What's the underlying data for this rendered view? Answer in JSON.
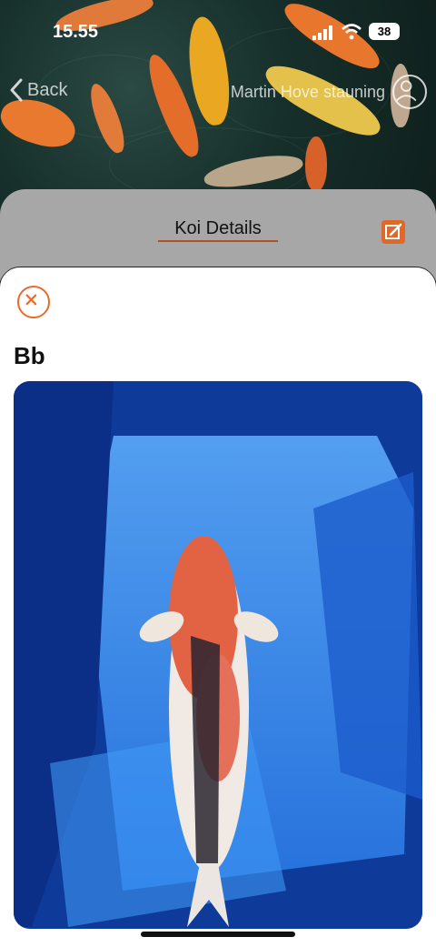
{
  "status_bar": {
    "time": "15.55",
    "battery": "38"
  },
  "nav": {
    "back_label": "Back",
    "user_name": "Martin Hove stauning"
  },
  "sheet": {
    "title": "Koi Details"
  },
  "koi": {
    "name": "Bb"
  },
  "colors": {
    "accent": "#e0692a",
    "sheet_bg": "#a7a7a7",
    "card_bg": "#ffffff"
  },
  "icons": {
    "back": "chevron-left-icon",
    "user": "user-avatar-icon",
    "edit": "edit-icon",
    "close": "close-icon"
  }
}
